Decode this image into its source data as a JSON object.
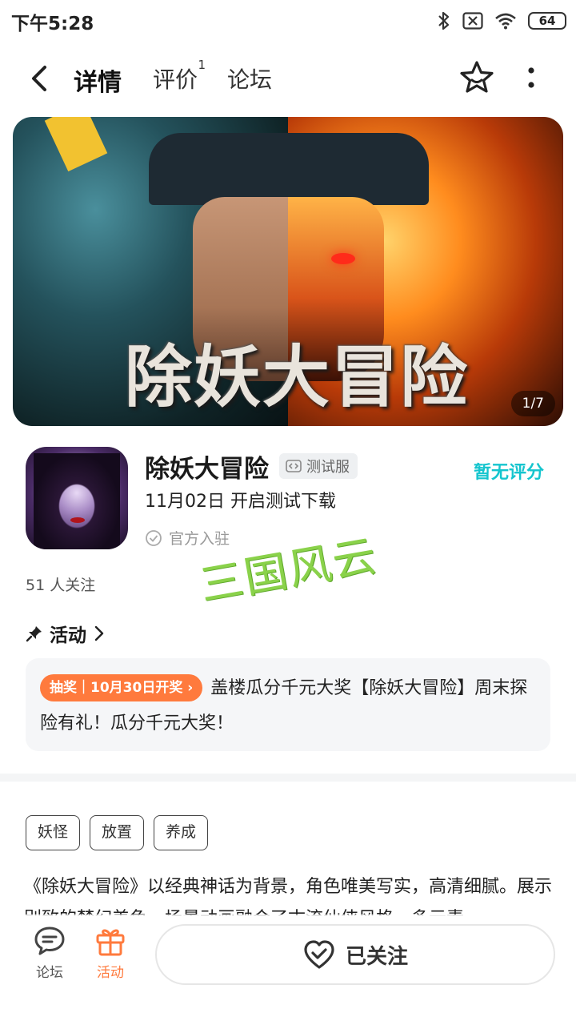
{
  "status_bar": {
    "time": "下午5:28",
    "battery": "64",
    "icons": [
      "bluetooth-icon",
      "sim-off-icon",
      "wifi-icon",
      "battery-icon"
    ]
  },
  "nav": {
    "tabs": [
      {
        "label": "详情",
        "active": true
      },
      {
        "label": "评价",
        "badge": "1"
      },
      {
        "label": "论坛"
      }
    ],
    "accent": "#15c5ce"
  },
  "banner": {
    "title_art": "除妖大冒险",
    "counter": "1/7"
  },
  "app": {
    "name": "除妖大冒险",
    "server_tag": "测试服",
    "rating": "暂无评分",
    "release": "11月02日 开启测试下载",
    "official": "官方入驻",
    "followers": "51 人关注"
  },
  "watermark": "三国风云",
  "activity": {
    "header": "活动",
    "badge": "抽奖｜10月30日开奖 ›",
    "text": "盖楼瓜分千元大奖【除妖大冒险】周末探险有礼！瓜分千元大奖！",
    "badge_color": "#ff7a3d"
  },
  "tags": [
    "妖怪",
    "放置",
    "养成"
  ],
  "description": "《除妖大冒险》以经典神话为背景，角色唯美写实，高清细腻。展示别致的梦幻美色，场景动画融合了古流仙侠风格，多元素",
  "bottom_bar": {
    "forum_label": "论坛",
    "activity_label": "活动",
    "follow_label": "已关注",
    "activity_color": "#ff7a3d"
  }
}
